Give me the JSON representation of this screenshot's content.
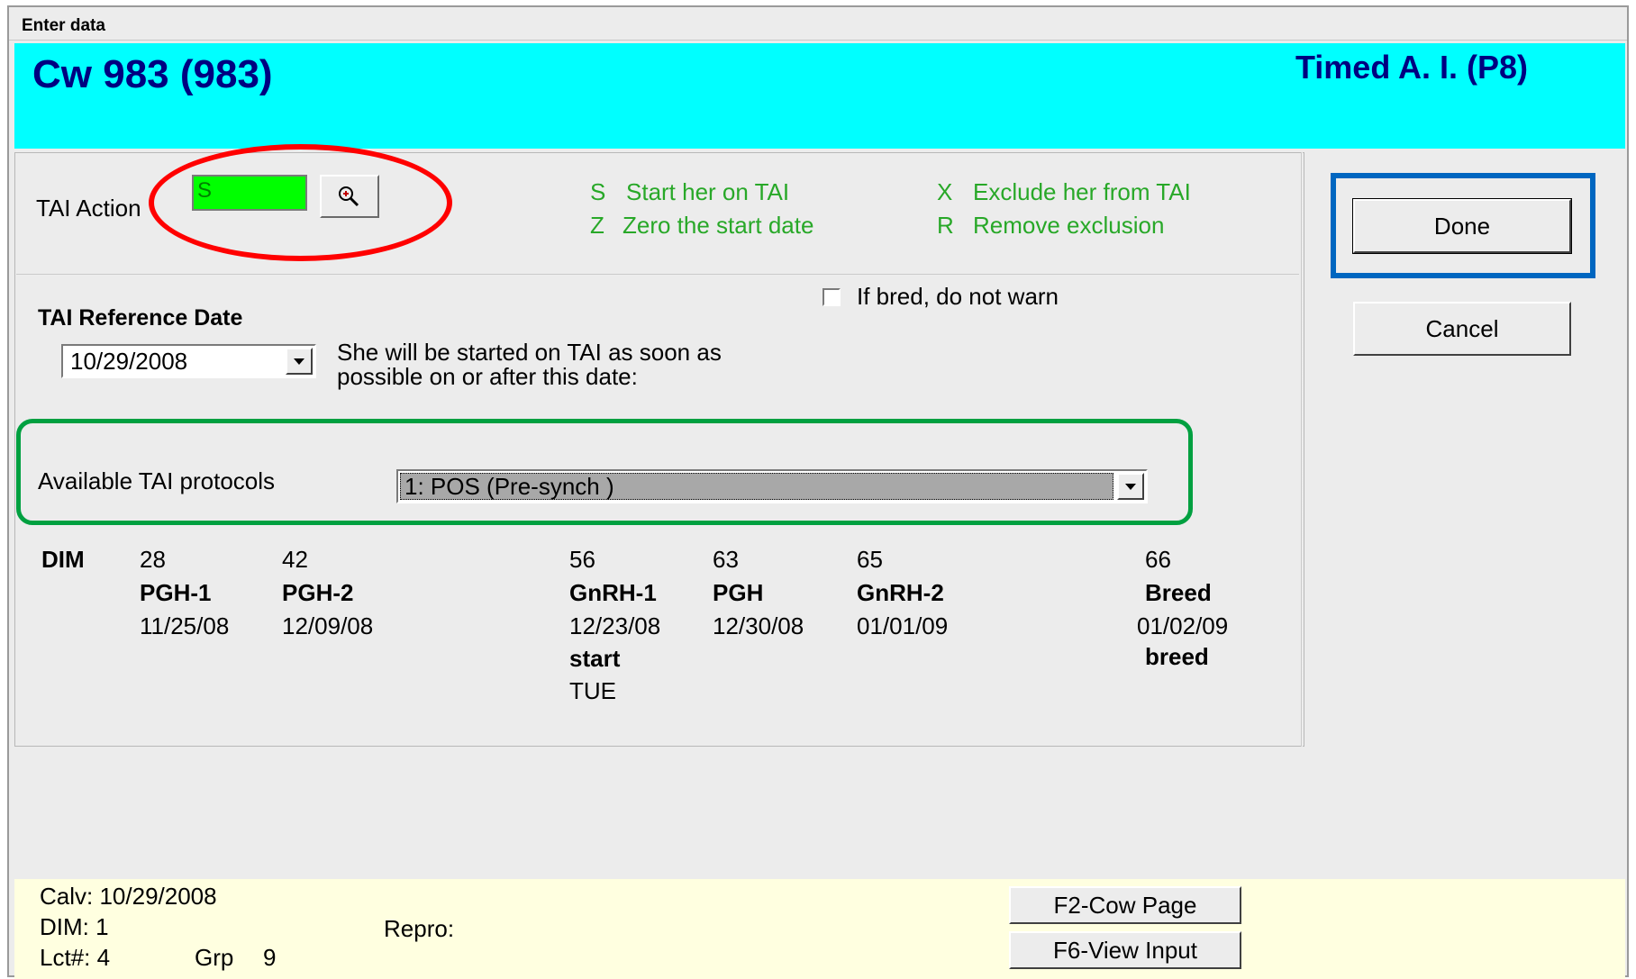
{
  "window": {
    "title": "Enter data"
  },
  "header": {
    "cow_title": "Cw 983 (983)",
    "event_title": "Timed A. I. (P8)"
  },
  "tai_action": {
    "label": "TAI Action",
    "value": "S",
    "codes": [
      {
        "code": "S",
        "text": "Start her on TAI"
      },
      {
        "code": "Z",
        "text": "Zero the start date"
      },
      {
        "code": "X",
        "text": "Exclude her from TAI"
      },
      {
        "code": "R",
        "text": "Remove exclusion"
      }
    ]
  },
  "buttons": {
    "done": "Done",
    "cancel": "Cancel"
  },
  "reference": {
    "heading": "TAI Reference Date",
    "date": "10/29/2008",
    "note_line1": "She will be started on TAI as soon as",
    "note_line2": "possible on or after this date:",
    "checkbox_label": "If bred, do not warn"
  },
  "protocols": {
    "label": "Available TAI protocols",
    "selected": "1: POS  (Pre-synch  )"
  },
  "schedule": {
    "dim_label": "DIM",
    "steps": [
      {
        "dim": "28",
        "event": "PGH-1",
        "date": "11/25/08",
        "note": "",
        "day": ""
      },
      {
        "dim": "42",
        "event": "PGH-2",
        "date": "12/09/08",
        "note": "",
        "day": ""
      },
      {
        "dim": "56",
        "event": "GnRH-1",
        "date": "12/23/08",
        "note": "start",
        "day": "TUE"
      },
      {
        "dim": "63",
        "event": "PGH",
        "date": "12/30/08",
        "note": "",
        "day": ""
      },
      {
        "dim": "65",
        "event": "GnRH-2",
        "date": "01/01/09",
        "note": "",
        "day": ""
      },
      {
        "dim": "66",
        "event": "Breed",
        "date": "01/02/09",
        "note": "breed",
        "day": ""
      }
    ]
  },
  "footer": {
    "calv": "Calv: 10/29/2008",
    "dim": "DIM: 1",
    "lct": "Lct#: 4",
    "grp_label": "Grp",
    "grp_value": "9",
    "repro": "Repro:",
    "f2": "F2-Cow Page",
    "f6": "F6-View Input"
  },
  "colors": {
    "header_bg": "#00ffff",
    "title_text": "#000080",
    "code_text": "#28a828",
    "tai_input_bg": "#00ff00",
    "footer_bg": "#ffffe0",
    "highlight_red": "#ff0000",
    "highlight_blue": "#0066c0",
    "highlight_green": "#00a040"
  }
}
